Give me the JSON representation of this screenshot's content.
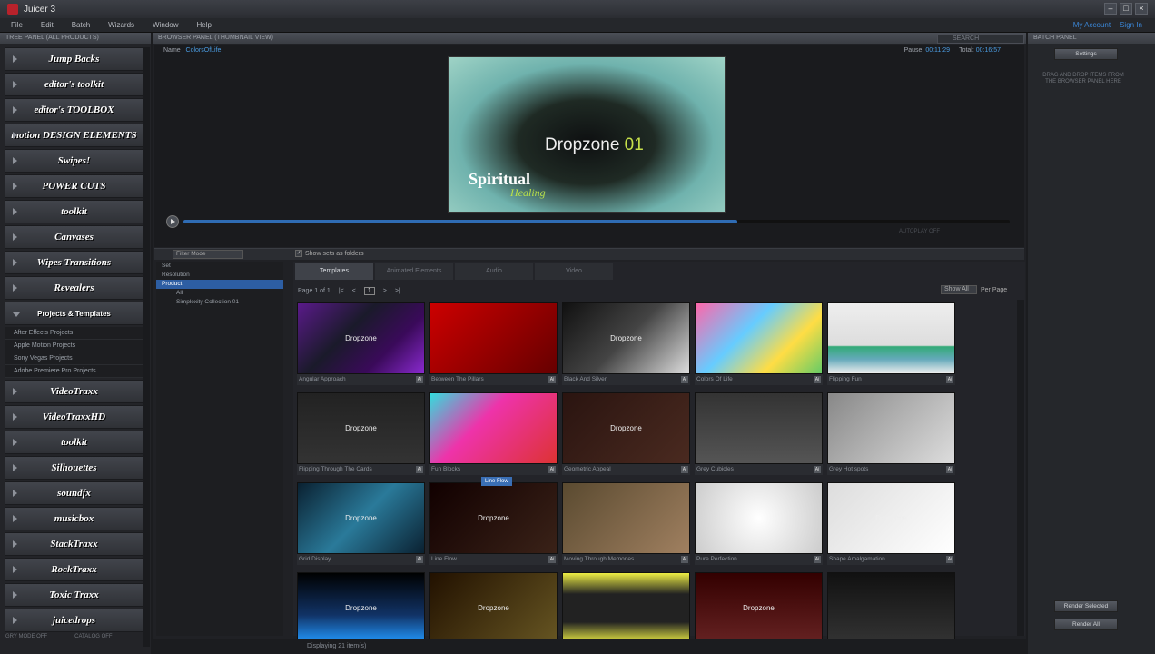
{
  "app": {
    "title": "Juicer 3",
    "menu": [
      "File",
      "Edit",
      "Batch",
      "Wizards",
      "Window",
      "Help"
    ],
    "account": [
      "My Account",
      "Sign In"
    ]
  },
  "left_panel": {
    "header": "TREE PANEL (ALL PRODUCTS)",
    "products": [
      "Jump Backs",
      "editor's toolkit",
      "editor's TOOLBOX",
      "motion DESIGN ELEMENTS",
      "Swipes!",
      "POWER CUTS",
      "toolkit",
      "Canvases",
      "Wipes Transitions",
      "Revealers"
    ],
    "expanded": "Projects & Templates",
    "subitems": [
      "After Effects Projects",
      "Apple Motion Projects",
      "Sony Vegas Projects",
      "Adobe Premiere Pro Projects"
    ],
    "products_after": [
      "VideoTraxx",
      "VideoTraxxHD",
      "toolkit",
      "Silhouettes",
      "soundfx",
      "musicbox",
      "StackTraxx",
      "RockTraxx",
      "Toxic Traxx",
      "juicedrops"
    ],
    "footer": [
      "GRY MODE OFF",
      "CATALOG OFF"
    ]
  },
  "browser": {
    "header": "BROWSER PANEL (THUMBNAIL VIEW)",
    "search_placeholder": "SEARCH",
    "name_label": "Name :",
    "name_value": "ColorsOfLife",
    "pause_label": "Pause:",
    "pause_value": "00:11:29",
    "total_label": "Total:",
    "total_value": "00:16:57",
    "progress": 0.67,
    "preview": {
      "title_a": "Dropzone ",
      "title_b": "01",
      "sub1": "Spiritual",
      "sub2": "Healing"
    },
    "autoplay": "AUTOPLAY OFF",
    "filter_mode": "Filter Mode",
    "show_sets": "Show sets as folders",
    "tree": [
      "Set",
      "Resolution",
      "Product",
      "All",
      "Simplexity Collection 01"
    ],
    "tabs": [
      "Templates",
      "Animated Elements",
      "Audio",
      "Video"
    ],
    "page_text": "Page 1 of 1",
    "page_num": "1",
    "nav": [
      "|<",
      "<",
      ">",
      ">|"
    ],
    "show_all": "Show All",
    "per_page": "Per Page",
    "thumbs": [
      "Angular Approach",
      "Between The Pillars",
      "Black And Silver",
      "Colors Of Life",
      "Flipping Fun",
      "Flipping Through The Cards",
      "Fun Blocks",
      "Geometric Appeal",
      "Grey Cubicles",
      "Grey Hot spots",
      "Grid Display",
      "Line Flow",
      "Moving Through Memories",
      "Pure Perfection",
      "Shape Amalgamation",
      "",
      "",
      "",
      "",
      ""
    ],
    "thumb_overlay": "Dropzone",
    "tooltip": "Line Flow",
    "status": "Displaying 21 item(s)"
  },
  "right_panel": {
    "header": "BATCH PANEL",
    "settings": "Settings",
    "desc": "DRAG AND DROP ITEMS FROM THE BROWSER PANEL HERE",
    "render_selected": "Render Selected",
    "render_all": "Render All"
  }
}
